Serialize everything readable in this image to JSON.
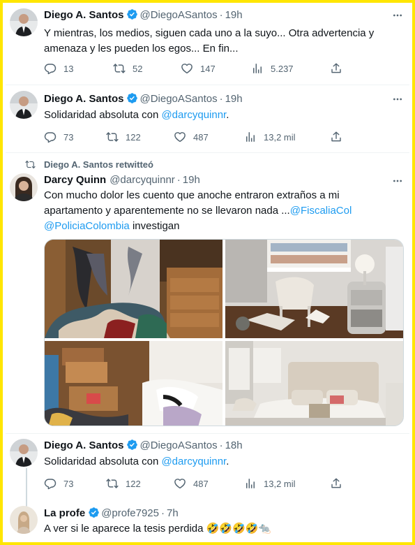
{
  "tweets": [
    {
      "name": "Diego A. Santos",
      "handle": "@DiegoASantos",
      "time": "19h",
      "text": "Y mientras, los medios, siguen cada uno a la suyo... Otra advertencia y amenaza y les pueden los egos... En fin...",
      "replies": "13",
      "retweets": "52",
      "likes": "147",
      "views": "5.237"
    },
    {
      "name": "Diego A. Santos",
      "handle": "@DiegoASantos",
      "time": "19h",
      "text_prefix": "Solidaridad absoluta con ",
      "text_link": "@darcyquinnr",
      "text_suffix": ".",
      "replies": "73",
      "retweets": "122",
      "likes": "487",
      "views": "13,2 mil"
    },
    {
      "retweeted_by": "Diego A. Santos retwitteó",
      "name": "Darcy Quinn",
      "handle": "@darcyquinnr",
      "time": "19h",
      "text_line1": "Con mucho dolor les cuento que anoche entraron extraños a mi",
      "text_line2_prefix": "apartamento y aparentemente no se llevaron nada ...",
      "text_link1": "@FiscaliaCol",
      "text_link2": "@PoliciaColombia",
      "text_suffix": " investigan"
    },
    {
      "name": "Diego A. Santos",
      "handle": "@DiegoASantos",
      "time": "18h",
      "text_prefix": "Solidaridad absoluta con ",
      "text_link": "@darcyquinnr",
      "text_suffix": ".",
      "replies": "73",
      "retweets": "122",
      "likes": "487",
      "views": "13,2 mil"
    },
    {
      "name": "La profe",
      "handle": "@profe7925",
      "time": "7h",
      "text": "A ver si le aparece la tesis perdida 🤣🤣🤣🤣🐀"
    }
  ],
  "dot": "·",
  "icons": {
    "reply": "reply-icon",
    "retweet": "retweet-icon",
    "like": "heart-icon",
    "views": "views-icon",
    "share": "share-icon",
    "more": "more-icon",
    "verified": "verified-badge-icon"
  },
  "colors": {
    "link": "#1d9bf0",
    "verified": "#1d9bf0",
    "border": "#ffe600",
    "muted": "#536471"
  }
}
